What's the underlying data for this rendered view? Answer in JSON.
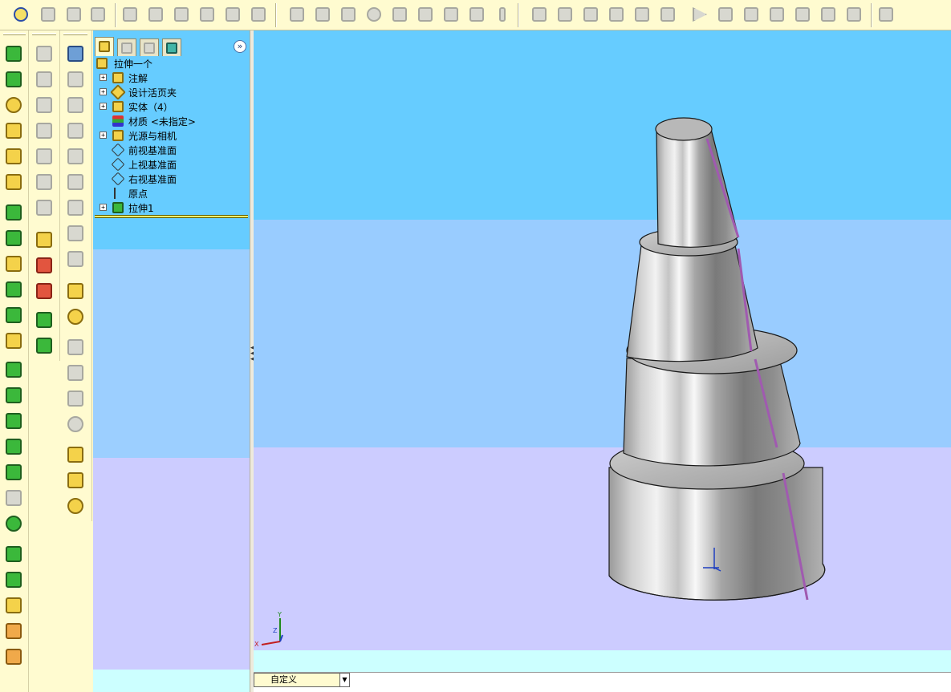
{
  "feature_manager": {
    "root": "拉伸一个",
    "items": [
      {
        "label": "注解",
        "expandable": true,
        "icon": "annotations-icon"
      },
      {
        "label": "设计活页夹",
        "expandable": true,
        "icon": "design-binder-icon"
      },
      {
        "label": "实体（4）",
        "expandable": true,
        "icon": "solid-bodies-icon"
      },
      {
        "label": "材质 <未指定>",
        "expandable": false,
        "icon": "material-icon"
      },
      {
        "label": "光源与相机",
        "expandable": true,
        "icon": "lights-cameras-icon"
      },
      {
        "label": "前视基准面",
        "expandable": false,
        "icon": "plane-icon"
      },
      {
        "label": "上视基准面",
        "expandable": false,
        "icon": "plane-icon"
      },
      {
        "label": "右视基准面",
        "expandable": false,
        "icon": "plane-icon"
      },
      {
        "label": "原点",
        "expandable": false,
        "icon": "origin-icon"
      },
      {
        "label": "拉伸1",
        "expandable": true,
        "icon": "extrude-feature-icon"
      }
    ],
    "tabs": [
      "feature-manager-tab",
      "property-manager-tab",
      "configuration-manager-tab",
      "dimxpert-tab"
    ],
    "expand_label": "»"
  },
  "config": {
    "selected": "自定义"
  },
  "viewport": {
    "triad": {
      "x": "X",
      "y": "Y",
      "z": "Z"
    }
  },
  "colors": {
    "toolbar_bg": "#fffbd0",
    "fm_bg": "#66ccff",
    "band_light": "#9ccfff",
    "band_purple": "#ccccff",
    "band_cyan": "#ccffff",
    "model_edge": "#1a1a1a",
    "model_face": "#a8a8a8",
    "highlight_line": "#a05ab0"
  }
}
